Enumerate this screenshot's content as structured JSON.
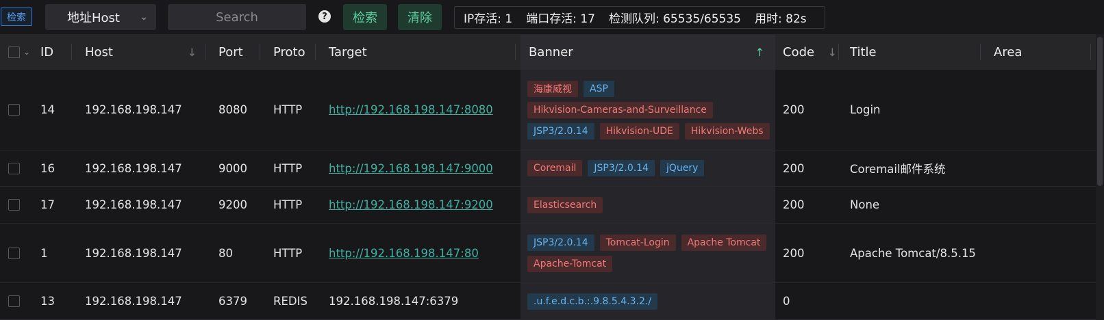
{
  "toolbar": {
    "retrieve_tag": "检索",
    "select_value": "地址Host",
    "search_placeholder": "Search",
    "help_icon": "?",
    "search_button": "检索",
    "clear_button": "清除",
    "status": {
      "ip_alive": "IP存活: 1",
      "port_alive": "端口存活: 17",
      "queue": "检测队列: 65535/65535",
      "elapsed": "用时: 82s"
    }
  },
  "table": {
    "headers": {
      "id": "ID",
      "host": "Host",
      "port": "Port",
      "proto": "Proto",
      "target": "Target",
      "banner": "Banner",
      "code": "Code",
      "title": "Title",
      "area": "Area"
    },
    "rows": [
      {
        "id": "14",
        "host": "192.168.198.147",
        "port": "8080",
        "proto": "HTTP",
        "target": "http://192.168.198.147:8080",
        "target_is_link": true,
        "banners": [
          {
            "text": "海康威视",
            "color": "red"
          },
          {
            "text": "ASP",
            "color": "blue"
          },
          {
            "text": "Hikvision-Cameras-and-Surveillance",
            "color": "red"
          },
          {
            "text": "JSP3/2.0.14",
            "color": "blue"
          },
          {
            "text": "Hikvision-UDE",
            "color": "red"
          },
          {
            "text": "Hikvision-Webs",
            "color": "red"
          }
        ],
        "code": "200",
        "title": "Login",
        "area": ""
      },
      {
        "id": "16",
        "host": "192.168.198.147",
        "port": "9000",
        "proto": "HTTP",
        "target": "http://192.168.198.147:9000",
        "target_is_link": true,
        "banners": [
          {
            "text": "Coremail",
            "color": "red"
          },
          {
            "text": "JSP3/2.0.14",
            "color": "blue"
          },
          {
            "text": "jQuery",
            "color": "blue"
          }
        ],
        "code": "200",
        "title": "Coremail邮件系统",
        "area": ""
      },
      {
        "id": "17",
        "host": "192.168.198.147",
        "port": "9200",
        "proto": "HTTP",
        "target": "http://192.168.198.147:9200",
        "target_is_link": true,
        "banners": [
          {
            "text": "Elasticsearch",
            "color": "red"
          }
        ],
        "code": "200",
        "title": "None",
        "area": ""
      },
      {
        "id": "1",
        "host": "192.168.198.147",
        "port": "80",
        "proto": "HTTP",
        "target": "http://192.168.198.147:80",
        "target_is_link": true,
        "banners": [
          {
            "text": "JSP3/2.0.14",
            "color": "blue"
          },
          {
            "text": "Tomcat-Login",
            "color": "red"
          },
          {
            "text": "Apache Tomcat",
            "color": "red"
          },
          {
            "text": "Apache-Tomcat",
            "color": "red"
          }
        ],
        "code": "200",
        "title": "Apache Tomcat/8.5.15",
        "area": ""
      },
      {
        "id": "13",
        "host": "192.168.198.147",
        "port": "6379",
        "proto": "REDIS",
        "target": "192.168.198.147:6379",
        "target_is_link": false,
        "banners": [
          {
            "text": ".u.f.e.d.c.b.:.9.8.5.4.3.2./",
            "color": "blue"
          }
        ],
        "code": "0",
        "title": "",
        "area": ""
      }
    ]
  },
  "colors": {
    "background": "#18181b",
    "accent_green": "#5fd0a0",
    "link": "#3fb0a0",
    "chip_red_text": "#f07a7a",
    "chip_blue_text": "#6ab4ee"
  }
}
